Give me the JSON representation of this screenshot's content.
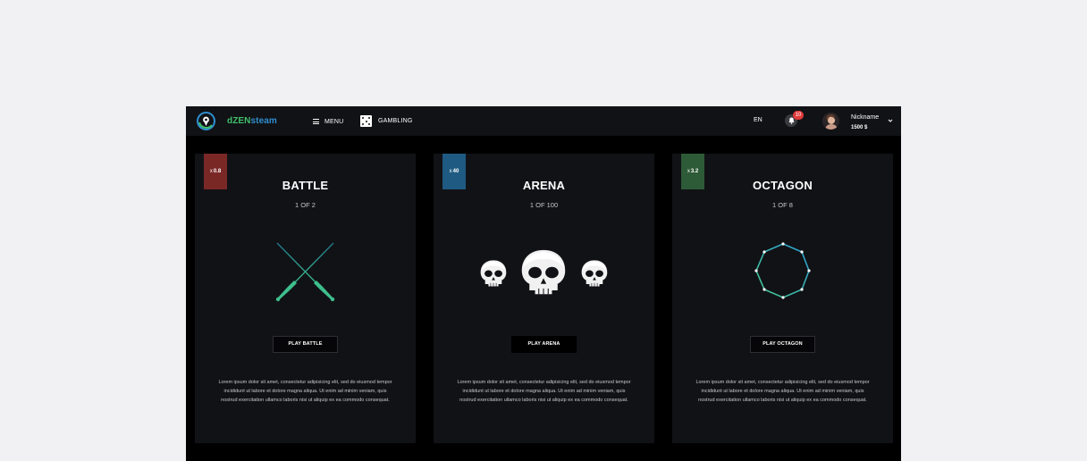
{
  "topbar": {
    "brand_part1": "dZEN",
    "brand_part2": "steam",
    "menu_label": "MENU",
    "gambling_label": "GAMBLING",
    "language": "EN",
    "notification_count": "10",
    "nickname": "Nickname",
    "balance": "1500 $"
  },
  "cards": [
    {
      "multiplier_prefix": "x",
      "multiplier": "0.8",
      "title": "BATTLE",
      "subtitle": "1 OF 2",
      "play_label": "PLAY BATTLE",
      "description": "Lorem ipsum dolor sit amet, consectetur adipisicing elit, sed do eiusmod tempor incididunt ut labore et dolore magna aliqua. Ut enim ad minim veniam, quis nostrud exercitation ullamco laboris nisi ut aliquip ex ea commodo consequat.",
      "badge_color": "#7a2826",
      "icon": "crossed-swords"
    },
    {
      "multiplier_prefix": "x",
      "multiplier": "40",
      "title": "ARENA",
      "subtitle": "1 OF 100",
      "play_label": "PLAY ARENA",
      "description": "Lorem ipsum dolor sit amet, consectetur adipisicing elit, sed do eiusmod tempor incididunt ut labore et dolore magna aliqua. Ut enim ad minim veniam, quis nostrud exercitation ullamco laboris nisi ut aliquip ex ea commodo consequat.",
      "badge_color": "#1f5a82",
      "icon": "skulls"
    },
    {
      "multiplier_prefix": "x",
      "multiplier": "3.2",
      "title": "OCTAGON",
      "subtitle": "1 OF 8",
      "play_label": "PLAY OCTAGON",
      "description": "Lorem ipsum dolor sit amet, consectetur adipisicing elit, sed do eiusmod tempor incididunt ut labore et dolore magna aliqua. Ut enim ad minim veniam, quis nostrud exercitation ullamco laboris nisi ut aliquip ex ea commodo consequat.",
      "badge_color": "#2e5b37",
      "icon": "octagon"
    }
  ],
  "colors": {
    "accent_green": "#3fbf6a",
    "accent_blue": "#2f8fd0",
    "notification_red": "#e13a3a"
  }
}
